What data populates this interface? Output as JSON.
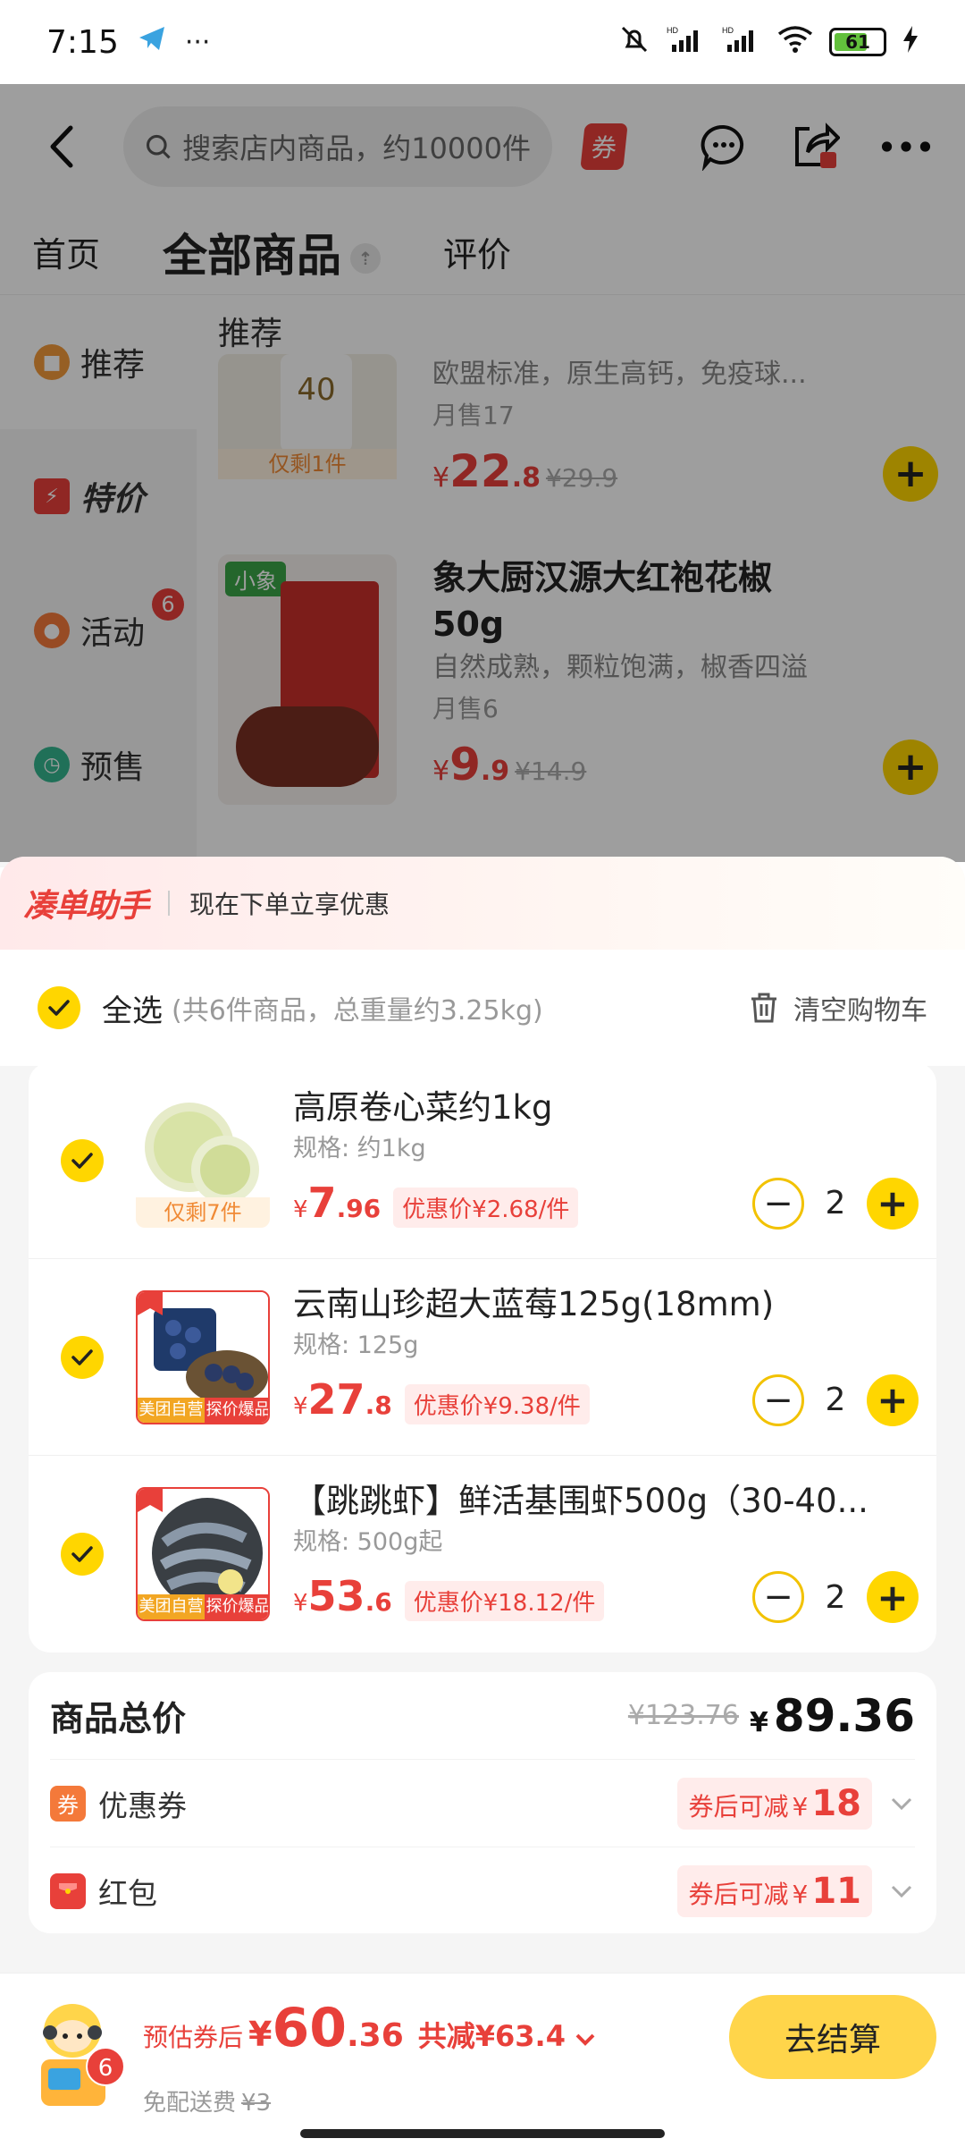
{
  "status_bar": {
    "time": "7:15",
    "battery": "61",
    "network": "HD"
  },
  "store": {
    "search_placeholder": "搜索店内商品，约10000件",
    "coupon_tag": "券",
    "tabs": [
      {
        "label": "首页"
      },
      {
        "label": "全部商品"
      },
      {
        "label": "评价"
      }
    ],
    "sidebar": [
      {
        "label": "推荐"
      },
      {
        "label": "特价"
      },
      {
        "label": "活动",
        "badge": "6"
      },
      {
        "label": "预售"
      }
    ],
    "section_title": "推荐",
    "products": [
      {
        "desc": "欧盟标准，原生高钙，免疫球...",
        "sales": "月售17",
        "price_int": "22",
        "price_dec": ".8",
        "orig": "¥29.9",
        "tag": "仅剩1件",
        "img_text": "40"
      },
      {
        "name": "象大厨汉源大红袍花椒50g",
        "desc": "自然成熟，颗粒饱满，椒香四溢",
        "sales": "月售6",
        "price_int": "9",
        "price_dec": ".9",
        "orig": "¥14.9",
        "badge": "小象"
      }
    ]
  },
  "cart": {
    "helper_title": "凑单助手",
    "helper_text": "现在下单立享优惠",
    "select_all": "全选",
    "select_summary": "(共6件商品，总重量约3.25kg)",
    "clear": "清空购物车",
    "items": [
      {
        "name": "高原卷心菜约1kg",
        "spec": "规格: 约1kg",
        "yen": "¥",
        "price_int": "7",
        "price_dec": ".96",
        "promo": "优惠价¥2.68/件",
        "qty": "2",
        "tag": "仅剩7件"
      },
      {
        "name": "云南山珍超大蓝莓125g(18mm)",
        "spec": "规格: 125g",
        "yen": "¥",
        "price_int": "27",
        "price_dec": ".8",
        "promo": "优惠价¥9.38/件",
        "qty": "2",
        "tag_left": "美团自营",
        "tag_right": "探价爆品"
      },
      {
        "name": "【跳跳虾】鲜活基围虾500g（30-40...",
        "spec": "规格: 500g起",
        "yen": "¥",
        "price_int": "53",
        "price_dec": ".6",
        "promo": "优惠价¥18.12/件",
        "qty": "2",
        "tag_left": "美团自营",
        "tag_right": "探价爆品"
      }
    ],
    "summary": {
      "title": "商品总价",
      "orig": "¥123.76",
      "total_yen": "¥",
      "total": "89.36",
      "coupon_icon": "券",
      "coupon_label": "优惠券",
      "coupon_pre": "券后可减",
      "coupon_yen": "¥",
      "coupon_amount": "18",
      "redpack_label": "红包",
      "redpack_pre": "券后可减",
      "redpack_yen": "¥",
      "redpack_amount": "11"
    },
    "footer": {
      "est_label": "预估券后",
      "yen": "¥",
      "est_int": "60",
      "est_dec": ".36",
      "save": "共减¥63.4",
      "ship_label": "免配送费",
      "ship_orig": "¥3",
      "cart_count": "6",
      "checkout": "去结算"
    }
  },
  "colors": {
    "accent": "#ffd600",
    "price": "#e8403a"
  }
}
